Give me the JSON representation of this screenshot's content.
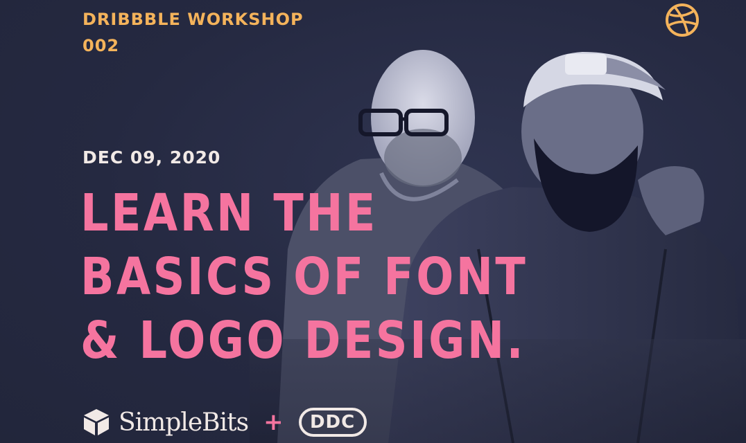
{
  "workshop": {
    "line1": "DRIBBBLE WORKSHOP",
    "line2": "002"
  },
  "date": "DEC 09, 2020",
  "headline": {
    "line1": "LEARN THE",
    "line2": "BASICS OF FONT",
    "line3": "& LOGO DESIGN."
  },
  "partners": {
    "simplebits": "SimpleBits",
    "plus": "+",
    "ddc": "DDC"
  },
  "colors": {
    "background": "#24283f",
    "accent_orange": "#f4b35b",
    "accent_pink": "#f5749f",
    "text_light": "#f1e9e6"
  },
  "icons": {
    "top_right": "dribbble-ball-icon",
    "simplebits": "simplebits-cube-icon"
  }
}
